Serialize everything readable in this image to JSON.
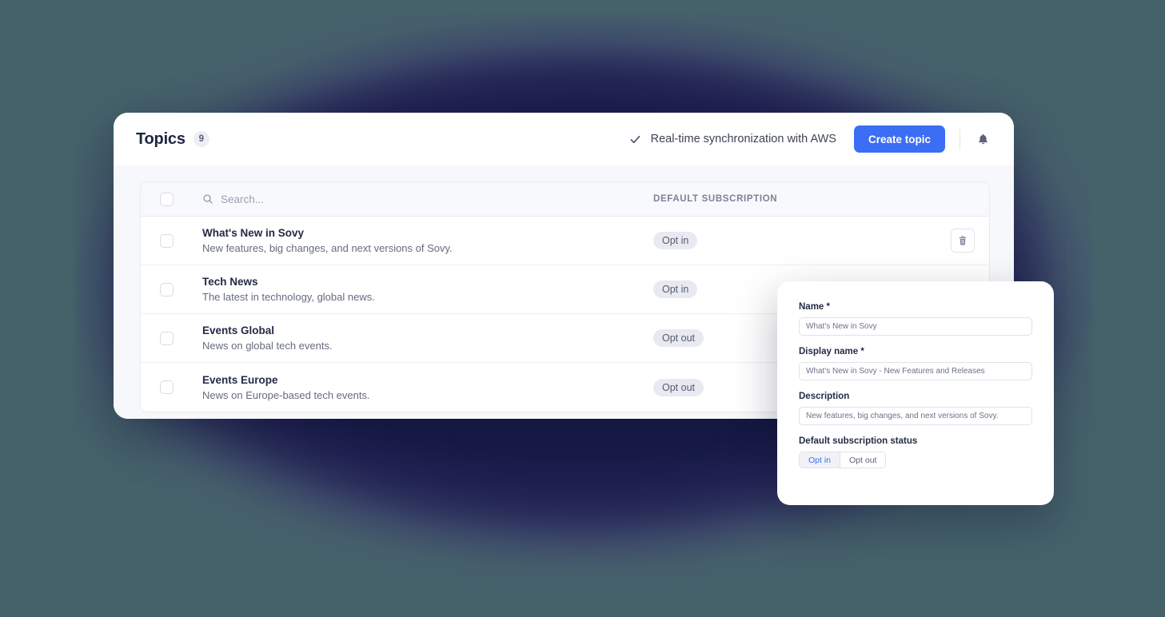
{
  "background": {
    "page_color": "#45626b",
    "glow_color": "#1d2150"
  },
  "header": {
    "title": "Topics",
    "count": "9",
    "sync_status_text": "Real-time synchronization with AWS",
    "sync_icon": "check-icon",
    "create_button_label": "Create topic",
    "create_button_color": "#3b6ef5",
    "bell_icon": "bell-icon"
  },
  "table": {
    "search_placeholder": "Search...",
    "search_value": "",
    "search_icon": "search-icon",
    "columns": {
      "subscription": "DEFAULT SUBSCRIPTION"
    },
    "rows": [
      {
        "name": "What's New in Sovy",
        "description": "New features, big changes, and next versions of Sovy.",
        "subscription": "Opt in",
        "delete_icon": "trash-icon"
      },
      {
        "name": "Tech News",
        "description": "The latest in technology, global news.",
        "subscription": "Opt in",
        "delete_icon": "trash-icon"
      },
      {
        "name": "Events Global",
        "description": "News on global tech events.",
        "subscription": "Opt out",
        "delete_icon": "trash-icon"
      },
      {
        "name": "Events Europe",
        "description": "News on Europe-based tech events.",
        "subscription": "Opt out",
        "delete_icon": "trash-icon"
      }
    ]
  },
  "edit_modal": {
    "name_label": "Name *",
    "name_value": "What's New in Sovy",
    "display_name_label": "Display name *",
    "display_name_value": "What's New in Sovy - New Features and Releases",
    "description_label": "Description",
    "description_value": "New features, big changes, and next versions of Sovy.",
    "subscription_label": "Default subscription status",
    "subscription_options": [
      {
        "label": "Opt in",
        "selected": true
      },
      {
        "label": "Opt out",
        "selected": false
      }
    ],
    "selected_accent": "#3b6ef5"
  }
}
